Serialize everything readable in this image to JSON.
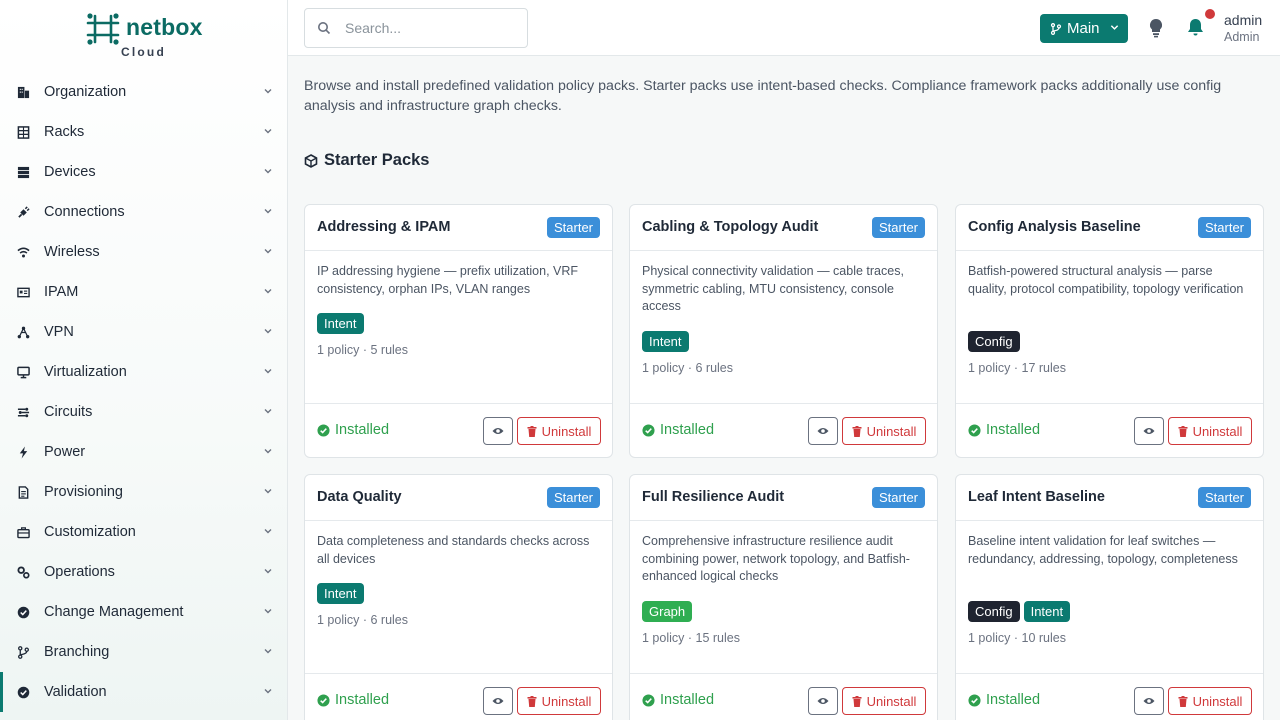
{
  "brand": {
    "name": "netbox",
    "sub": "Cloud",
    "color": "#0b6b63"
  },
  "nav": [
    {
      "label": "Organization",
      "icon": "building-icon"
    },
    {
      "label": "Racks",
      "icon": "rack-icon"
    },
    {
      "label": "Devices",
      "icon": "server-icon"
    },
    {
      "label": "Connections",
      "icon": "plug-icon"
    },
    {
      "label": "Wireless",
      "icon": "wifi-icon"
    },
    {
      "label": "IPAM",
      "icon": "network-card-icon"
    },
    {
      "label": "VPN",
      "icon": "vpn-icon"
    },
    {
      "label": "Virtualization",
      "icon": "monitor-icon"
    },
    {
      "label": "Circuits",
      "icon": "circuit-icon"
    },
    {
      "label": "Power",
      "icon": "bolt-icon"
    },
    {
      "label": "Provisioning",
      "icon": "document-icon"
    },
    {
      "label": "Customization",
      "icon": "toolbox-icon"
    },
    {
      "label": "Operations",
      "icon": "gears-icon"
    },
    {
      "label": "Change Management",
      "icon": "badge-check-icon"
    },
    {
      "label": "Branching",
      "icon": "branch-icon"
    },
    {
      "label": "Validation",
      "icon": "badge-check-icon"
    }
  ],
  "search": {
    "placeholder": "Search..."
  },
  "branch": {
    "label": "Main"
  },
  "user": {
    "name": "admin",
    "role": "Admin"
  },
  "intro": "Browse and install predefined validation policy packs. Starter packs use intent-based checks. Compliance framework packs additionally use config analysis and infrastructure graph checks.",
  "section_title": "Starter Packs",
  "actions": {
    "installed": "Installed",
    "uninstall": "Uninstall"
  },
  "packs": [
    {
      "title": "Addressing & IPAM",
      "badge": "Starter",
      "desc": "IP addressing hygiene — prefix utilization, VRF consistency, orphan IPs, VLAN ranges",
      "tags": [
        "Intent"
      ],
      "meta": "1 policy · 5 rules"
    },
    {
      "title": "Cabling & Topology Audit",
      "badge": "Starter",
      "desc": "Physical connectivity validation — cable traces, symmetric cabling, MTU consistency, console access",
      "tags": [
        "Intent"
      ],
      "meta": "1 policy · 6 rules"
    },
    {
      "title": "Config Analysis Baseline",
      "badge": "Starter",
      "desc": "Batfish-powered structural analysis — parse quality, protocol compatibility, topology verification",
      "tags": [
        "Config"
      ],
      "meta": "1 policy · 17 rules"
    },
    {
      "title": "Data Quality",
      "badge": "Starter",
      "desc": "Data completeness and standards checks across all devices",
      "tags": [
        "Intent"
      ],
      "meta": "1 policy · 6 rules"
    },
    {
      "title": "Full Resilience Audit",
      "badge": "Starter",
      "desc": "Comprehensive infrastructure resilience audit combining power, network topology, and Batfish-enhanced logical checks",
      "tags": [
        "Graph"
      ],
      "meta": "1 policy · 15 rules"
    },
    {
      "title": "Leaf Intent Baseline",
      "badge": "Starter",
      "desc": "Baseline intent validation for leaf switches — redundancy, addressing, topology, completeness",
      "tags": [
        "Config",
        "Intent"
      ],
      "meta": "1 policy · 10 rules"
    }
  ]
}
